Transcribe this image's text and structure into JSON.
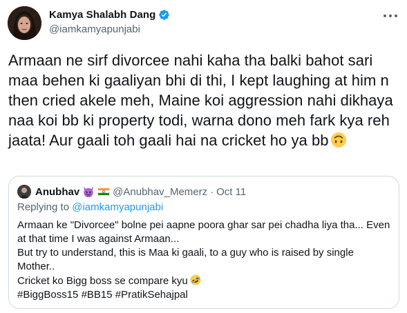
{
  "tweet": {
    "display_name": "Kamya Shalabh Dang",
    "handle": "@iamkamyapunjabi",
    "verified_icon": "verified-badge-icon",
    "more_icon": "more-options-icon",
    "body": "Armaan ne sirf divorcee nahi kaha tha balki bahot sari maa behen ki gaaliyan bhi di thi, I kept laughing at him n then cried akele meh, Maine koi aggression nahi dikhaya naa koi bb ki property todi, warna dono meh fark kya reh jaata! Aur gaali toh gaali hai na cricket ho ya bb",
    "body_emoji": "upside-down-face-emoji"
  },
  "quote": {
    "display_name": "Anubhav",
    "emojis": [
      "smiling-imp-emoji",
      "india-flag-emoji"
    ],
    "handle": "@Anubhav_Memerz",
    "separator": "·",
    "date": "Oct 11",
    "replying_prefix": "Replying to",
    "replying_handle": "@iamkamyapunjabi",
    "lines": [
      "Armaan ke \"Divorcee\" bolne pei aapne poora ghar sar pei chadha liya tha... Even",
      "at that time I was against Armaan...",
      "But try to understand, this is Maa ki gaali, to a guy who is raised by single",
      "Mother..",
      "Cricket ko Bigg boss se compare kyu",
      "#BiggBoss15 #BB15 #PratikSehajpal"
    ],
    "line5_emoji": "rolling-on-floor-laughing-emoji"
  },
  "colors": {
    "text": "#0f1419",
    "secondary": "#536471",
    "link": "#1d9bf0",
    "border": "#cfd9de",
    "verified": "#1d9bf0"
  }
}
